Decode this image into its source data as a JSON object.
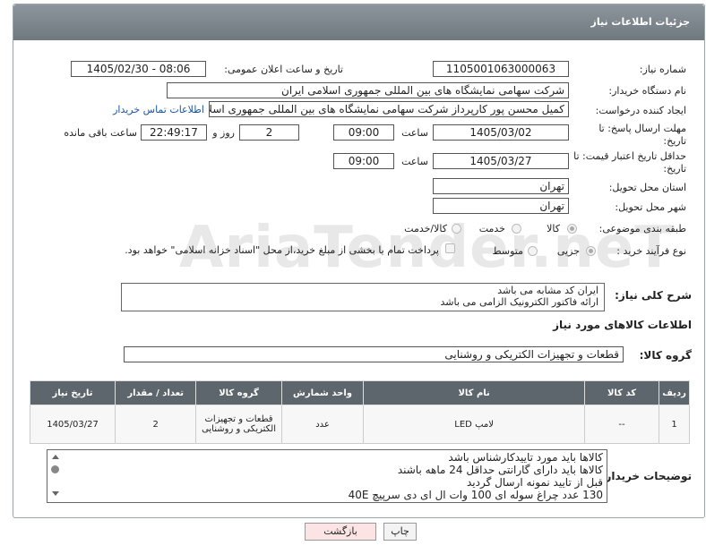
{
  "panel_title": "جزئیات اطلاعات نیاز",
  "fields": {
    "need_number_label": "شماره نیاز:",
    "need_number": "1105001063000063",
    "announce_label": "تاریخ و ساعت اعلان عمومی:",
    "announce_value": "1405/02/30 - 08:06",
    "buyer_org_label": "نام دستگاه خریدار:",
    "buyer_org": "شرکت سهامی نمایشگاه های بین المللی جمهوری اسلامی ایران",
    "requester_label": "ایجاد کننده درخواست:",
    "requester": "کمیل محسن پور کارپرداز شرکت سهامی نمایشگاه های بین المللی جمهوری اسلامی ایران",
    "contact_link": "اطلاعات تماس خریدار",
    "reply_deadline_label": "مهلت ارسال پاسخ: تا تاریخ:",
    "reply_date": "1405/03/02",
    "time_label": "ساعت",
    "reply_time": "09:00",
    "day_and": "روز و",
    "days_left": "2",
    "time_left": "22:49:17",
    "time_left_label": "ساعت باقی مانده",
    "price_validity_label": "حداقل تاریخ اعتبار قیمت: تا تاریخ:",
    "price_date": "1405/03/27",
    "price_time": "09:00",
    "province_label": "استان محل تحویل:",
    "province": "تهران",
    "city_label": "شهر محل تحویل:",
    "city": "تهران",
    "category_label": "طبقه بندی موضوعی:",
    "cat_goods": "کالا",
    "cat_service": "خدمت",
    "cat_both": "کالا/خدمت",
    "process_label": "نوع فرآیند خرید :",
    "proc_partial": "جزیی",
    "proc_medium": "متوسط",
    "payment_note": "پرداخت تمام یا بخشی از مبلغ خرید،از محل \"اسناد خزانه اسلامی\" خواهد بود."
  },
  "general_desc_label": "شرح کلی نیاز:",
  "general_desc": [
    "ایران کد مشابه می باشد",
    "ارائه فاکتور الکترونیک الزامی می باشد"
  ],
  "goods_info_title": "اطلاعات کالاهای مورد نیاز",
  "goods_group_label": "گروه کالا:",
  "goods_group": "قطعات و تجهیزات الکتریکی و روشنایی",
  "table": {
    "headers": [
      "ردیف",
      "کد کالا",
      "نام کالا",
      "واحد شمارش",
      "گروه کالا",
      "تعداد / مقدار",
      "تاریخ نیاز"
    ],
    "rows": [
      [
        "1",
        "--",
        "لامپ LED",
        "عدد",
        "قطعات و تجهیزات الکتریکی و روشنایی",
        "2",
        "1405/03/27"
      ]
    ]
  },
  "buyer_notes_label": "توضیحات خریدار:",
  "buyer_notes": [
    "کالاها باید مورد تاییدکارشناس باشد",
    "کالاها باید دارای گارانتی حداقل 24 ماهه باشند",
    "قبل از تایید نمونه ارسال گردید",
    "130 عدد چراغ سوله ای 100 وات ال ای دی سرپیچ 40E"
  ],
  "buttons": {
    "print": "چاپ",
    "back": "بازگشت"
  },
  "watermark": "AriaTender.neT"
}
